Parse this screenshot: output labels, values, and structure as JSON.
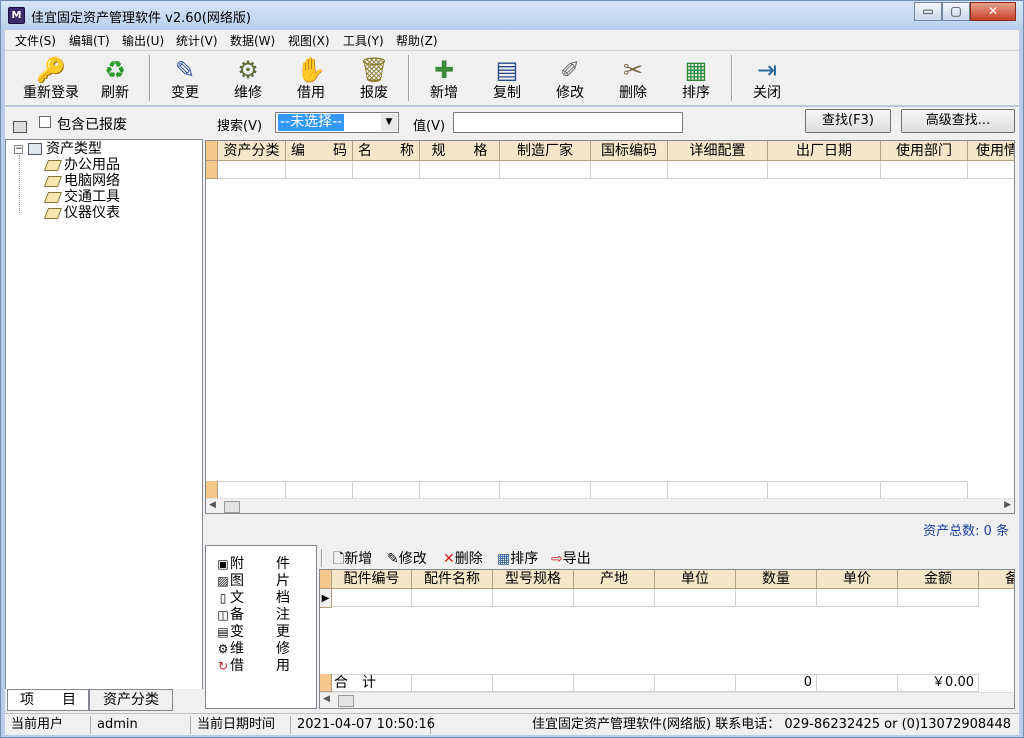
{
  "window": {
    "title": "佳宜固定资产管理软件 v2.60(网络版)",
    "icon": "app-book-icon",
    "controls": {
      "minimize": "▭",
      "maximize": "▢",
      "close": "✕"
    }
  },
  "menu": [
    {
      "label": "文件(S)"
    },
    {
      "label": "编辑(T)"
    },
    {
      "label": "输出(U)"
    },
    {
      "label": "统计(V)"
    },
    {
      "label": "数据(W)"
    },
    {
      "label": "视图(X)"
    },
    {
      "label": "工具(Y)"
    },
    {
      "label": "帮助(Z)"
    }
  ],
  "toolbar": [
    {
      "label": "重新登录",
      "icon": "login-icon",
      "glyph": "🔑"
    },
    {
      "label": "刷新",
      "icon": "refresh-icon",
      "glyph": "♻"
    },
    {
      "label": "变更",
      "icon": "change-icon",
      "glyph": "✎"
    },
    {
      "label": "维修",
      "icon": "repair-icon",
      "glyph": "⚙"
    },
    {
      "label": "借用",
      "icon": "borrow-icon",
      "glyph": "✋"
    },
    {
      "label": "报废",
      "icon": "scrap-icon",
      "glyph": "🗑"
    },
    {
      "label": "新增",
      "icon": "add-icon",
      "glyph": "✚"
    },
    {
      "label": "复制",
      "icon": "copy-icon",
      "glyph": "▤"
    },
    {
      "label": "修改",
      "icon": "edit-icon",
      "glyph": "✐"
    },
    {
      "label": "删除",
      "icon": "delete-icon",
      "glyph": "✂"
    },
    {
      "label": "排序",
      "icon": "sort-icon",
      "glyph": "▦"
    },
    {
      "label": "关闭",
      "icon": "exit-icon",
      "glyph": "⇥"
    }
  ],
  "search": {
    "include_scrapped_label": "包含已报废",
    "include_scrapped_checked": false,
    "search_label": "搜索(V)",
    "search_selected": "--未选择--",
    "value_label": "值(V)",
    "value": "",
    "find_button": "查找(F3)",
    "advanced_button": "高级查找..."
  },
  "tree": {
    "root": "资产类型",
    "children": [
      "办公用品",
      "电脑网络",
      "交通工具",
      "仪器仪表"
    ]
  },
  "grid": {
    "columns": [
      "资产分类",
      "编　　码",
      "名　　称",
      "规　　格",
      "制造厂家",
      "国标编码",
      "详细配置",
      "出厂日期",
      "使用部门",
      "使用情"
    ]
  },
  "asset_count": "资产总数: 0 条",
  "attachments": [
    {
      "a": "附",
      "b": "件",
      "icon": "attachment-icon",
      "glyph": "▣"
    },
    {
      "a": "图",
      "b": "片",
      "icon": "picture-icon",
      "glyph": "▨"
    },
    {
      "a": "文",
      "b": "档",
      "icon": "document-icon",
      "glyph": "▯"
    },
    {
      "a": "备",
      "b": "注",
      "icon": "note-icon",
      "glyph": "◫"
    },
    {
      "a": "变",
      "b": "更",
      "icon": "change-icon",
      "glyph": "▤"
    },
    {
      "a": "维",
      "b": "修",
      "icon": "repair-icon",
      "glyph": "⚙"
    },
    {
      "a": "借",
      "b": "用",
      "icon": "borrow-icon",
      "glyph": "↻"
    }
  ],
  "sub_toolbar": [
    {
      "label": "新增",
      "icon": "new-doc-icon",
      "glyph": "🗋"
    },
    {
      "label": "修改",
      "icon": "edit-icon",
      "glyph": "✎"
    },
    {
      "label": "删除",
      "icon": "delete-x-icon",
      "glyph": "✕"
    },
    {
      "label": "排序",
      "icon": "sort-icon",
      "glyph": "▦"
    },
    {
      "label": "导出",
      "icon": "export-icon",
      "glyph": "⇨"
    }
  ],
  "sub_grid": {
    "columns": [
      "配件编号",
      "配件名称",
      "型号规格",
      "产地",
      "单位",
      "数量",
      "单价",
      "金额",
      "备"
    ],
    "total_label": "合　计",
    "total_qty": "0",
    "total_amount": "￥0.00"
  },
  "tabs": [
    "项　　目",
    "资产分类"
  ],
  "status": {
    "user_label": "当前用户",
    "user": "admin",
    "datetime_label": "当前日期时间",
    "datetime": "2021-04-07 10:50:16",
    "info": "佳宜固定资产管理软件(网络版)  联系电话： 029-86232425 or (0)13072908448"
  }
}
